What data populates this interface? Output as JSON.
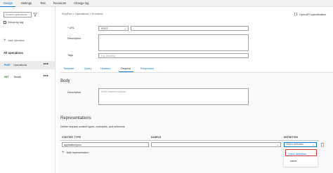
{
  "top_tabs": [
    {
      "label": "Design",
      "active": true
    },
    {
      "label": "Settings",
      "active": false
    },
    {
      "label": "Test",
      "active": false
    },
    {
      "label": "Revisions",
      "active": false
    },
    {
      "label": "Change log",
      "active": false
    }
  ],
  "sidebar": {
    "search_placeholder": "Search operations",
    "filter_icon": "filter-icon",
    "group_by_tag_label": "Group by tag",
    "add_operation_label": "Add operation",
    "all_operations_label": "All operations",
    "operations": [
      {
        "method": "POST",
        "name": "OperationA",
        "method_color": "#0078d4",
        "selected": true,
        "more": "•••"
      },
      {
        "method": "GET",
        "name": "TestAll",
        "method_color": "#107c10",
        "selected": false,
        "more": "•••"
      }
    ]
  },
  "header": {
    "breadcrumb": "FuryFun > OperationA > Frontend",
    "openapi_label": "OpenAPI specification"
  },
  "form": {
    "url_label": "URL",
    "url_required": "*",
    "method_value": "POST",
    "url_placeholder": "/",
    "description_label": "Description",
    "tags_label": "Tags",
    "tags_placeholder": "e.g. Booking"
  },
  "sub_tabs": [
    {
      "label": "Template",
      "active": false
    },
    {
      "label": "Query",
      "active": false
    },
    {
      "label": "Headers",
      "active": false
    },
    {
      "label": "Request",
      "active": true
    },
    {
      "label": "Responses",
      "active": false
    }
  ],
  "body_section": {
    "title": "Body",
    "description_label": "Description",
    "description_placeholder": "Enter request payload"
  },
  "representations": {
    "title": "Representations",
    "description": "Define request content types, examples, and schemas.",
    "columns": [
      "CONTENT TYPE",
      "SAMPLE",
      "DEFINITION"
    ],
    "row": {
      "content_type": "application/json",
      "sample": "",
      "definition_placeholder": "Select definition"
    },
    "add_label": "Add representation",
    "dropdown": {
      "new_definition": "+ New definition",
      "items": [
        "name"
      ]
    }
  },
  "colors": {
    "accent": "#0078d4",
    "highlight": "#d13438",
    "post": "#0078d4",
    "get": "#107c10"
  }
}
